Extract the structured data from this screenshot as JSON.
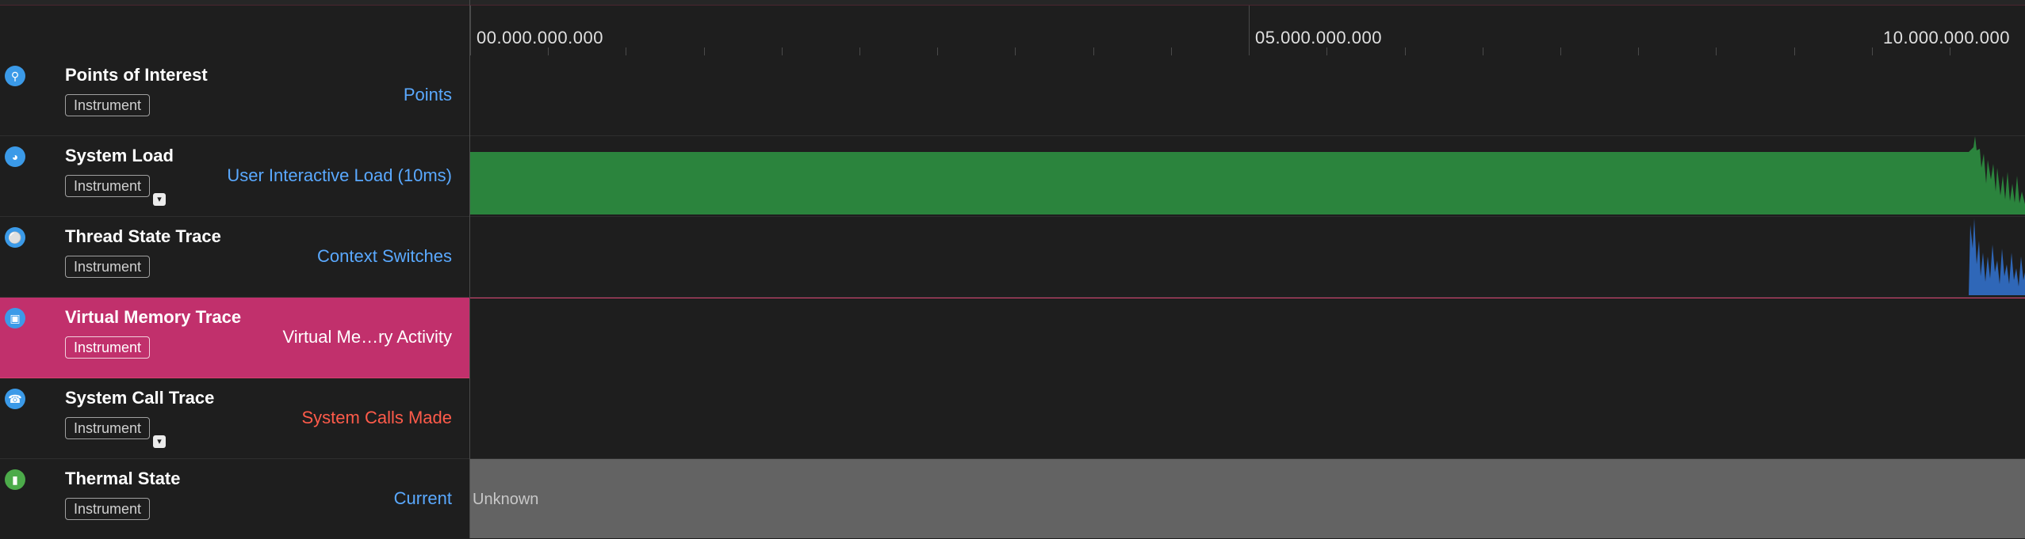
{
  "ruler": {
    "labels": [
      "00.000.000.000",
      "05.000.000.000",
      "10.000.000.000"
    ]
  },
  "tracks": [
    {
      "name": "Points of Interest",
      "badge": "Instrument",
      "detail": "Points",
      "icon": "pin-icon",
      "has_dropdown": false
    },
    {
      "name": "System Load",
      "badge": "Instrument",
      "detail": "User Interactive Load (10ms)",
      "icon": "gauge-icon",
      "has_dropdown": true
    },
    {
      "name": "Thread State Trace",
      "badge": "Instrument",
      "detail": "Context Switches",
      "icon": "thread-icon",
      "has_dropdown": false
    },
    {
      "name": "Virtual Memory Trace",
      "badge": "Instrument",
      "detail": "Virtual Me…ry Activity",
      "icon": "memory-icon",
      "has_dropdown": false,
      "selected": true
    },
    {
      "name": "System Call Trace",
      "badge": "Instrument",
      "detail": "System Calls Made",
      "icon": "phone-icon",
      "has_dropdown": true
    },
    {
      "name": "Thermal State",
      "badge": "Instrument",
      "detail": "Current",
      "icon": "thermometer-icon",
      "has_dropdown": false
    }
  ],
  "thermal_lane": {
    "state": "Unknown"
  },
  "colors": {
    "selection": "#c1306c",
    "system_load_bar": "#2b843d",
    "context_switch": "#2f67b8",
    "detail_link": "#5aa9ff",
    "detail_alert": "#ff5b4a",
    "thermal_unknown": "#636363"
  }
}
